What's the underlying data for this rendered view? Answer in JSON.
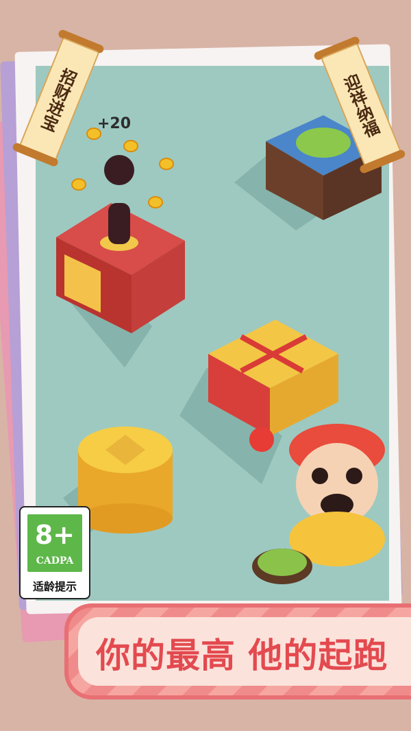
{
  "scrolls": {
    "left": "招财进宝",
    "right": "迎祥纳福"
  },
  "score_popup": "+20",
  "rating_badge": {
    "age": "8+",
    "org": "CADPA",
    "hint": "适龄提示"
  },
  "banner": {
    "slogan": "你的最高  他的起跑"
  },
  "colors": {
    "board": "#9ec9c1",
    "banner_text": "#e34a4f",
    "badge_green": "#5eb749"
  }
}
